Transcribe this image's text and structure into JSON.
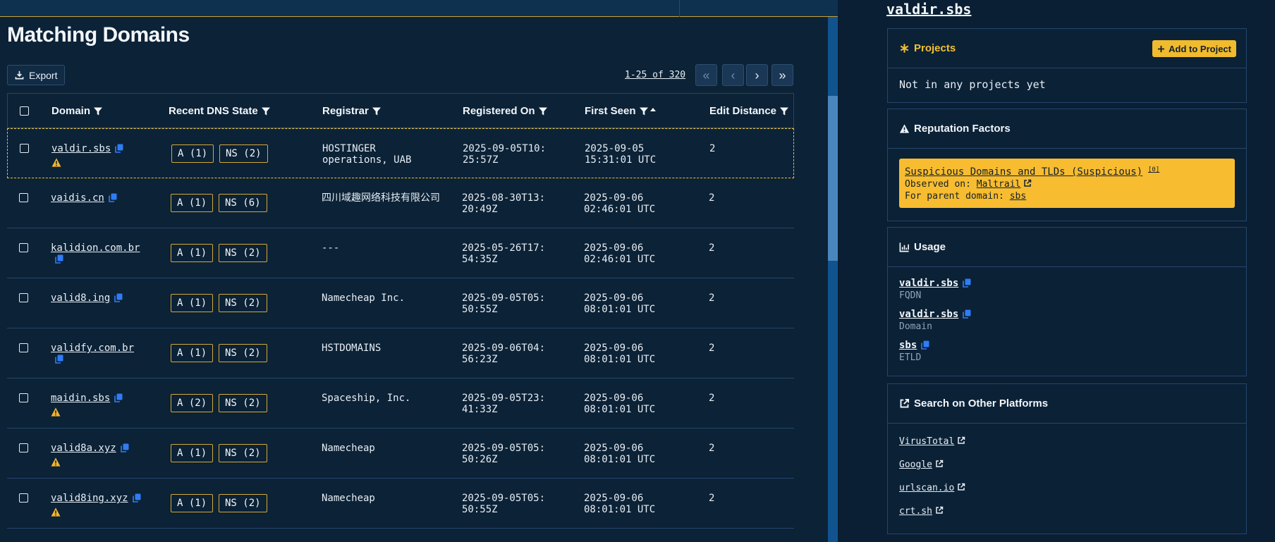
{
  "list": {
    "title": "Matching Domains",
    "export_label": "Export",
    "pagination": {
      "text": "1-25 of 320",
      "first": "«",
      "prev": "‹",
      "next": "›",
      "last": "»"
    },
    "columns": {
      "domain": "Domain",
      "dns": "Recent DNS State",
      "registrar": "Registrar",
      "registered": "Registered On",
      "first_seen": "First Seen",
      "edit_distance": "Edit Distance"
    },
    "rows": [
      {
        "domain": "valdir.sbs",
        "warning": true,
        "a": "A (1)",
        "ns": "NS (2)",
        "registrar": "HOSTINGER operations, UAB",
        "registered": "2025-09-05T10:25:57Z",
        "first_seen": "2025-09-05 15:31:01 UTC",
        "edit": "2",
        "selected": true
      },
      {
        "domain": "vaidis.cn",
        "warning": false,
        "a": "A (1)",
        "ns": "NS (6)",
        "registrar": "四川域趣网络科技有限公司",
        "registered": "2025-08-30T13:20:49Z",
        "first_seen": "2025-09-06 02:46:01 UTC",
        "edit": "2",
        "selected": false
      },
      {
        "domain": "kalidion.com.br",
        "warning": false,
        "a": "A (1)",
        "ns": "NS (2)",
        "registrar": "---",
        "registered": "2025-05-26T17:54:35Z",
        "first_seen": "2025-09-06 02:46:01 UTC",
        "edit": "2",
        "selected": false
      },
      {
        "domain": "valid8.ing",
        "warning": false,
        "a": "A (1)",
        "ns": "NS (2)",
        "registrar": "Namecheap Inc.",
        "registered": "2025-09-05T05:50:55Z",
        "first_seen": "2025-09-06 08:01:01 UTC",
        "edit": "2",
        "selected": false
      },
      {
        "domain": "validfy.com.br",
        "warning": false,
        "a": "A (1)",
        "ns": "NS (2)",
        "registrar": "HSTDOMAINS",
        "registered": "2025-09-06T04:56:23Z",
        "first_seen": "2025-09-06 08:01:01 UTC",
        "edit": "2",
        "selected": false
      },
      {
        "domain": "maidin.sbs",
        "warning": true,
        "a": "A (2)",
        "ns": "NS (2)",
        "registrar": "Spaceship, Inc.",
        "registered": "2025-09-05T23:41:33Z",
        "first_seen": "2025-09-06 08:01:01 UTC",
        "edit": "2",
        "selected": false
      },
      {
        "domain": "valid8a.xyz",
        "warning": true,
        "a": "A (1)",
        "ns": "NS (2)",
        "registrar": "Namecheap",
        "registered": "2025-09-05T05:50:26Z",
        "first_seen": "2025-09-06 08:01:01 UTC",
        "edit": "2",
        "selected": false
      },
      {
        "domain": "valid8ing.xyz",
        "warning": true,
        "a": "A (1)",
        "ns": "NS (2)",
        "registrar": "Namecheap",
        "registered": "2025-09-05T05:50:55Z",
        "first_seen": "2025-09-06 08:01:01 UTC",
        "edit": "2",
        "selected": false
      }
    ]
  },
  "detail": {
    "title": "valdir.sbs",
    "projects": {
      "heading": "Projects",
      "add_label": "Add to Project",
      "empty": "Not in any projects yet"
    },
    "reputation": {
      "heading": "Reputation Factors",
      "factor_title": "Suspicious Domains and TLDs (Suspicious)",
      "factor_ref": "[0]",
      "observed_label": "Observed on:",
      "observed_source": "Maltrail",
      "parent_label": "For parent domain:",
      "parent_domain": "sbs"
    },
    "usage": {
      "heading": "Usage",
      "items": [
        {
          "name": "valdir.sbs",
          "type": "FQDN"
        },
        {
          "name": "valdir.sbs",
          "type": "Domain"
        },
        {
          "name": "sbs",
          "type": "ETLD"
        }
      ]
    },
    "platforms": {
      "heading": "Search on Other Platforms",
      "links": [
        "VirusTotal",
        "Google",
        "urlscan.io",
        "crt.sh"
      ]
    }
  },
  "colors": {
    "accent_yellow": "#f7bc30",
    "copy_blue": "#2f7cf6",
    "panel_bg": "#0c2236",
    "scrollbar": "#11538e"
  },
  "icons": {
    "copy": "copy-icon",
    "warning": "warning-icon",
    "filter": "filter-icon",
    "sort": "sort-asc-icon",
    "external": "external-link-icon"
  }
}
